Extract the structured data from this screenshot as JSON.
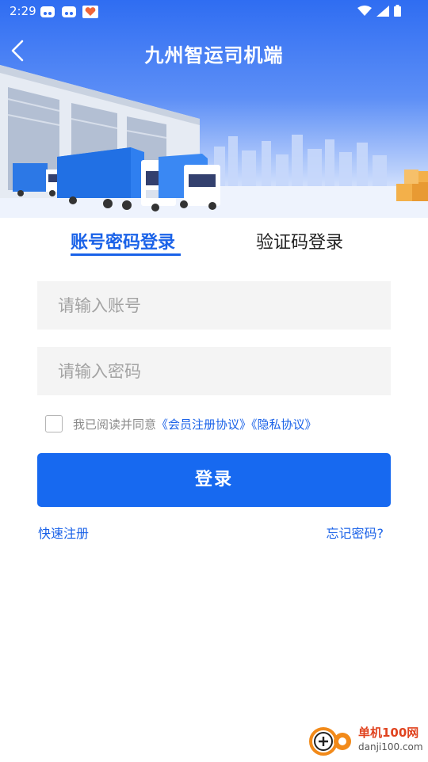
{
  "status_bar": {
    "time": "2:29"
  },
  "header": {
    "title": "九州智运司机端"
  },
  "tabs": [
    {
      "label": "账号密码登录",
      "active": true
    },
    {
      "label": "验证码登录",
      "active": false
    }
  ],
  "form": {
    "account_placeholder": "请输入账号",
    "password_placeholder": "请输入密码",
    "agreement_prefix": "我已阅读并同意",
    "agreement_link1": "《会员注册协议》",
    "agreement_link2": "《隐私协议》",
    "agreement_checked": false
  },
  "login_button": "登录",
  "links": {
    "quick_register": "快速注册",
    "forgot_password": "忘记密码?"
  },
  "watermark": {
    "line1": "单机100网",
    "line2": "danji100.com"
  },
  "colors": {
    "accent": "#1769f0",
    "banner_top": "#2f6df2",
    "input_bg": "#f4f4f4"
  }
}
